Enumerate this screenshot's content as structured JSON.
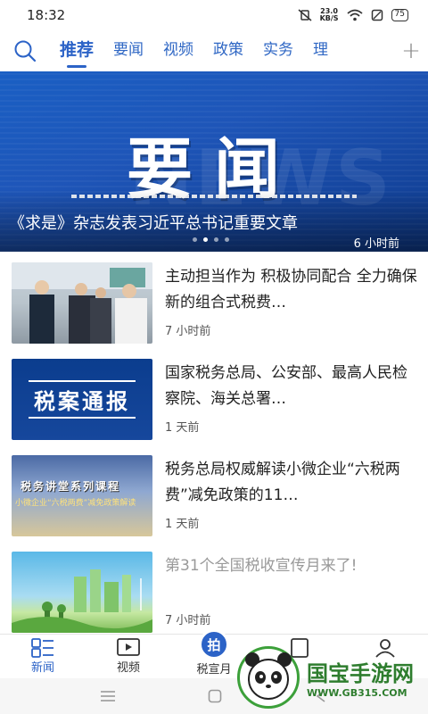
{
  "status_bar": {
    "time": "18:32",
    "net_speed_value": "23.0",
    "net_speed_unit": "KB/S",
    "battery": "75"
  },
  "top_nav": {
    "tabs": [
      {
        "label": "推荐",
        "active": true
      },
      {
        "label": "要闻"
      },
      {
        "label": "视频"
      },
      {
        "label": "政策"
      },
      {
        "label": "实务"
      },
      {
        "label": "理"
      }
    ],
    "add_label": "+"
  },
  "banner": {
    "big_text": "要闻",
    "deco_text": "NEWS",
    "title": "《求是》杂志发表习近平总书记重要文章",
    "time": "6 小时前",
    "dot_count": 4,
    "active_dot": 1
  },
  "news": [
    {
      "title": "主动担当作为 积极协同配合 全力确保新的组合式税费…",
      "time": "7 小时前"
    },
    {
      "title": "国家税务总局、公安部、最高人民检察院、海关总署…",
      "time": "1 天前",
      "thumb_text": "税案通报"
    },
    {
      "title": "税务总局权威解读小微企业“六税两费”减免政策的11…",
      "time": "1 天前",
      "thumb_text": "税务讲堂系列课程",
      "thumb_sub": "小微企业“六税两费”减免政策解读"
    },
    {
      "title": "第31个全国税收宣传月来了!",
      "time": "7 小时前"
    }
  ],
  "bottom_nav": {
    "items": [
      {
        "label": "新闻",
        "icon": "news-grid-icon",
        "active": true
      },
      {
        "label": "视频",
        "icon": "video-play-icon"
      },
      {
        "label": "税宣月",
        "icon": "拍"
      }
    ]
  },
  "watermark": {
    "brand": "国宝手游网",
    "url": "WWW.GB315.COM"
  },
  "colors": {
    "accent": "#2c63c7",
    "banner_blue": "#1a5fc4"
  }
}
